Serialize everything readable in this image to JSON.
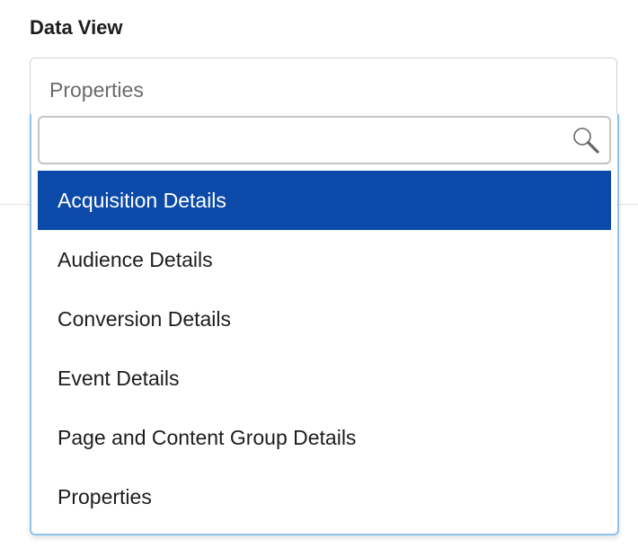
{
  "field": {
    "label": "Data View",
    "selected_value": "Properties"
  },
  "search": {
    "placeholder": "",
    "value": "",
    "icon": "search-icon"
  },
  "options": [
    {
      "label": "Acquisition Details",
      "highlighted": true
    },
    {
      "label": "Audience Details",
      "highlighted": false
    },
    {
      "label": "Conversion Details",
      "highlighted": false
    },
    {
      "label": "Event Details",
      "highlighted": false
    },
    {
      "label": "Page and Content Group Details",
      "highlighted": false
    },
    {
      "label": "Properties",
      "highlighted": false
    }
  ],
  "colors": {
    "highlight_bg": "#0b4aa8",
    "highlight_text": "#ffffff",
    "dropdown_border": "#8cc4ec"
  }
}
